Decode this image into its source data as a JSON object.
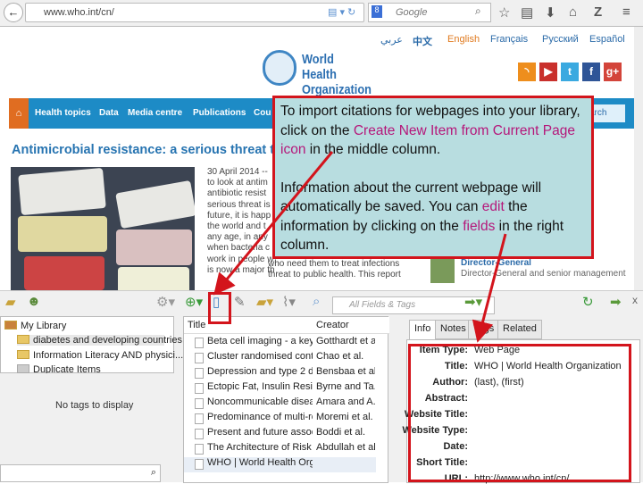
{
  "browser": {
    "url": "www.who.int/cn/",
    "search_placeholder": "Google"
  },
  "site": {
    "languages": [
      "عربي",
      "中文",
      "English",
      "Français",
      "Русский",
      "Español"
    ],
    "logo_text": [
      "World Health",
      "Organization"
    ],
    "social": [
      "rss",
      "youtube",
      "twitter",
      "facebook",
      "google-plus"
    ],
    "nav": [
      "Health topics",
      "Data",
      "Media centre",
      "Publications",
      "Cou"
    ],
    "search_label": "arch",
    "headline": "Antimicrobial resistance: a serious threat t",
    "article_lines": [
      "30 April 2014 --",
      "to look at antim",
      "antibiotic resist",
      "serious threat is",
      "future, it is happ",
      "the world and t",
      "any age, in any",
      "when bacteria c",
      "work in people wh",
      "is now a major thr"
    ],
    "article_tail": [
      "who need them to treat infections",
      "threat to public health. This report"
    ],
    "dg_title": "Director-General",
    "dg_sub": "Director-General and senior management"
  },
  "callout": {
    "p1_a": "To import citations for webpages into your library, click on the ",
    "p1_hl": "Create New Item from Current Page icon",
    "p1_b": " in the middle column.",
    "p2_a": "Information about the current webpage will automatically be saved. You can ",
    "p2_hl1": "edit",
    "p2_b": " the information by clicking on the ",
    "p2_hl2": "fields",
    "p2_c": " in the right column."
  },
  "zotero": {
    "filter_placeholder": "All Fields & Tags",
    "collections": [
      {
        "label": "My Library"
      },
      {
        "label": "diabetes and developing countries"
      },
      {
        "label": "Information Literacy AND physici..."
      },
      {
        "label": "Duplicate Items"
      }
    ],
    "no_tags": "No tags to display",
    "columns": {
      "title": "Title",
      "creator": "Creator"
    },
    "items": [
      {
        "title": "Beta cell imaging - a key t...",
        "creator": "Gotthardt et al."
      },
      {
        "title": "Cluster randomised contr...",
        "creator": "Chao et al."
      },
      {
        "title": "Depression and type 2 dia...",
        "creator": "Bensbaa et al."
      },
      {
        "title": "Ectopic Fat, Insulin Resista...",
        "creator": "Byrne and Ta..."
      },
      {
        "title": "Noncommunicable diseas...",
        "creator": "Amara and A..."
      },
      {
        "title": "Predominance of multi-re...",
        "creator": "Moremi et al."
      },
      {
        "title": "Present and future associa...",
        "creator": "Boddi et al."
      },
      {
        "title": "The Architecture of Risk fo...",
        "creator": "Abdullah et al."
      },
      {
        "title": "WHO | World Health Orga...",
        "creator": ""
      }
    ],
    "tabs": [
      "Info",
      "Notes",
      "Tags",
      "Related"
    ],
    "fields": [
      {
        "label": "Item Type:",
        "value": "Web Page"
      },
      {
        "label": "Title:",
        "value": "WHO | World Health Organization"
      },
      {
        "label": "Author:",
        "value": "(last), (first)"
      },
      {
        "label": "Abstract:",
        "value": ""
      },
      {
        "label": "Website Title:",
        "value": ""
      },
      {
        "label": "Website Type:",
        "value": ""
      },
      {
        "label": "Date:",
        "value": ""
      },
      {
        "label": "Short Title:",
        "value": ""
      },
      {
        "label": "URL:",
        "value": "http://www.who.int/cn/"
      }
    ]
  },
  "colors": {
    "highlight": "#d3141c",
    "callout_bg": "#b8dde0",
    "nav_blue": "#1d8bc6",
    "accent_text": "#b5177a"
  }
}
